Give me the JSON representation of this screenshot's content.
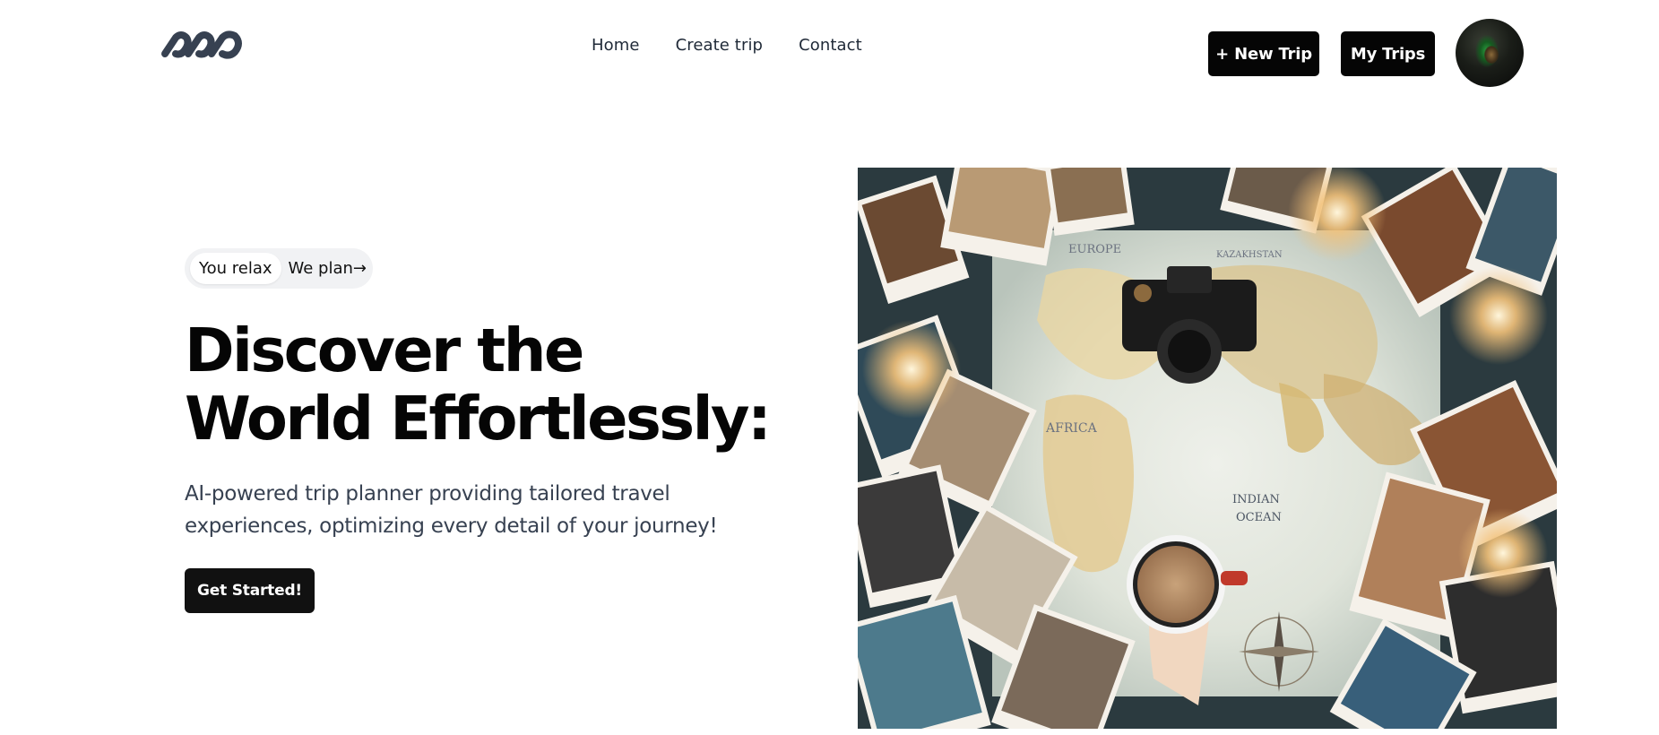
{
  "nav": {
    "links": [
      "Home",
      "Create trip",
      "Contact"
    ]
  },
  "header": {
    "new_trip_label": "+ New Trip",
    "my_trips_label": "My Trips"
  },
  "hero": {
    "pill_left": "You relax",
    "pill_right": "We plan→",
    "title_line1": "Discover the",
    "title_line2": "World Effortlessly:",
    "description": "AI-powered trip planner providing tailored travel experiences, optimizing every detail of your journey!",
    "cta_label": "Get Started!"
  },
  "photo": {
    "map_labels": [
      "EUROPE",
      "KAZAKHSTAN",
      "AFRICA",
      "INDIAN",
      "OCEAN"
    ]
  },
  "colors": {
    "button_bg": "#050505",
    "text_dark": "#050505",
    "text_muted": "#374151",
    "pill_bg": "#f1f2f4"
  }
}
